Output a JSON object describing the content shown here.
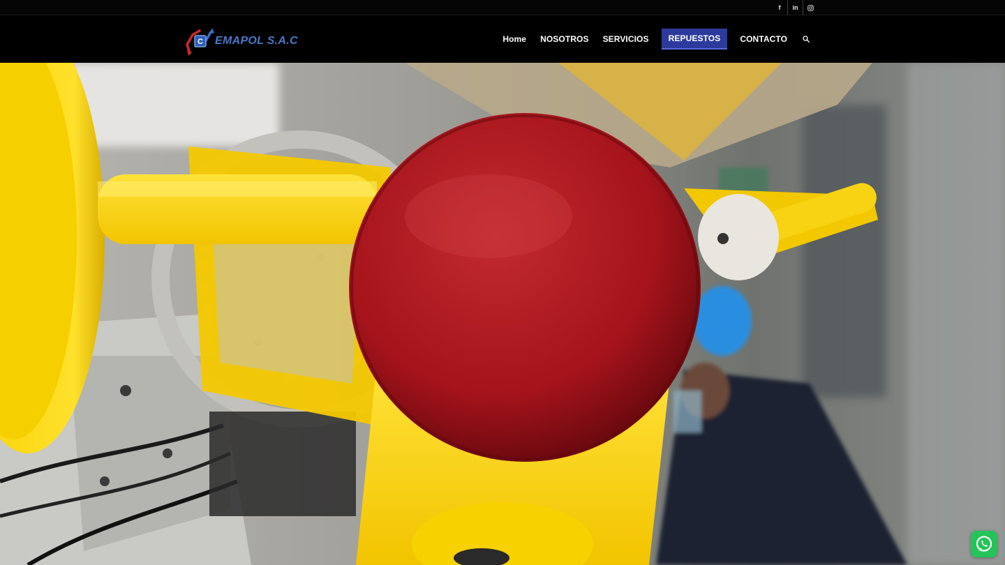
{
  "social": {
    "items": [
      {
        "label": "f",
        "icon": "facebook-icon"
      },
      {
        "label": "in",
        "icon": "linkedin-icon"
      },
      {
        "label": "◎",
        "icon": "instagram-icon"
      }
    ]
  },
  "header": {
    "logo_text": "EMAPOL S.A.C",
    "nav": [
      {
        "label": "Home"
      },
      {
        "label": "NOSOTROS"
      },
      {
        "label": "SERVICIOS"
      },
      {
        "label": "REPUESTOS",
        "active": true
      },
      {
        "label": "CONTACTO"
      }
    ],
    "search_icon": "search-icon"
  },
  "hero": {
    "image": "industrial-machinery-photo"
  },
  "whatsapp": {
    "icon": "whatsapp-icon"
  },
  "colors": {
    "nav_active_bg": "#2b3a9c",
    "logo_blue": "#4a78c8",
    "logo_red": "#d02a2a",
    "whatsapp_green": "#25c35a"
  }
}
